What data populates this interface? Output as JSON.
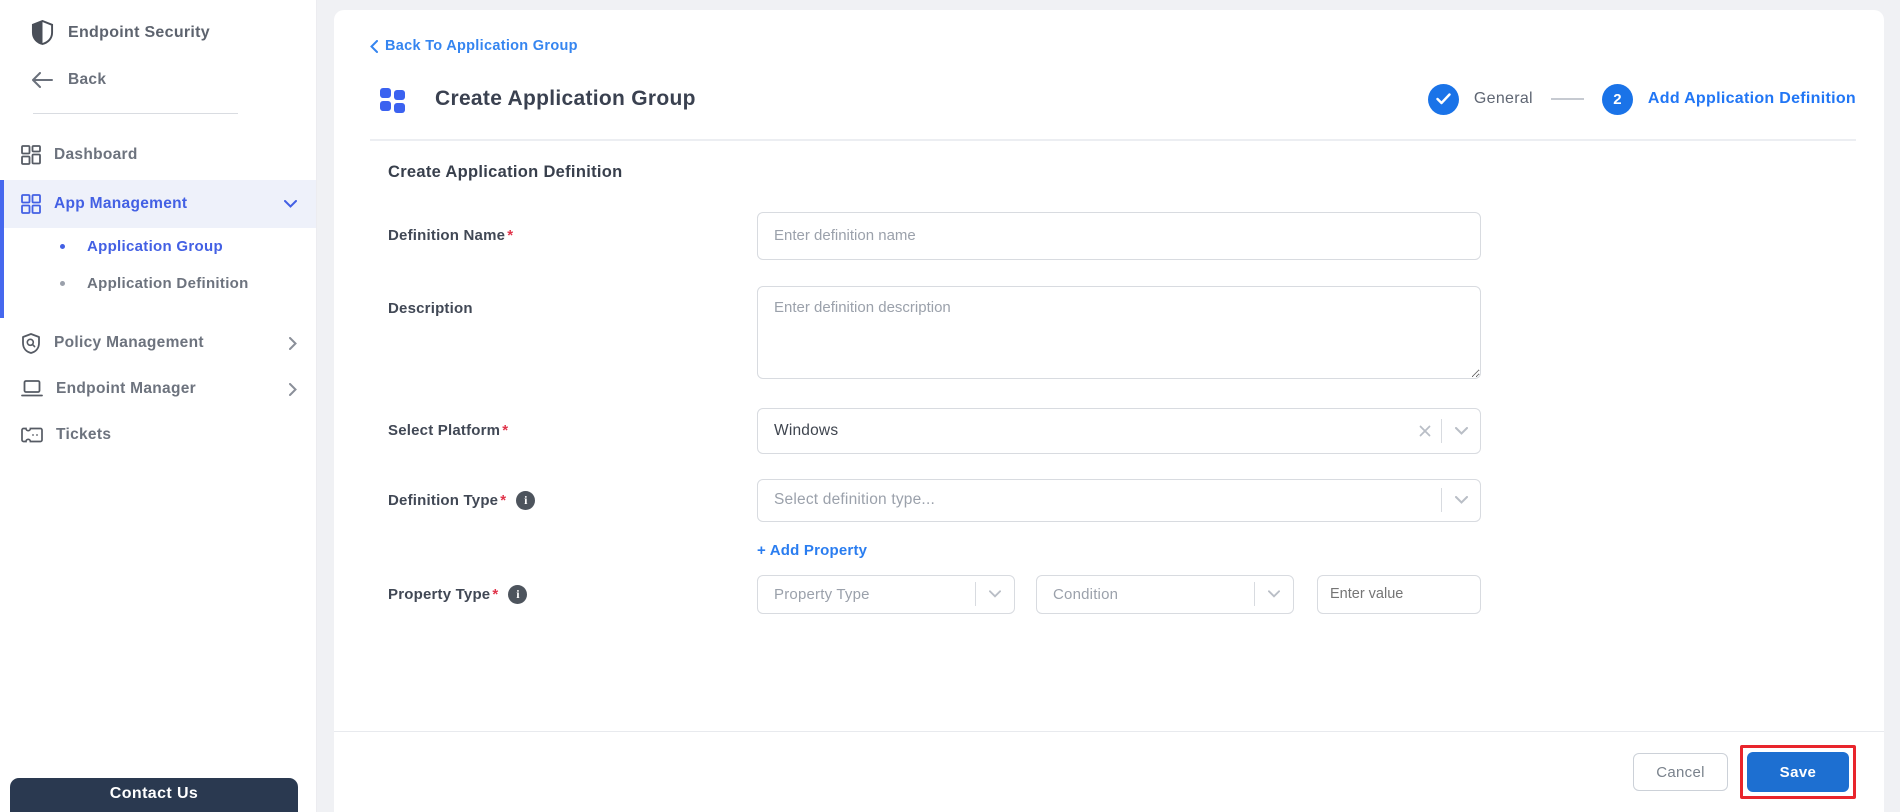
{
  "brand": {
    "name": "Endpoint Security",
    "back_label": "Back",
    "contact_us_label": "Contact Us"
  },
  "sidebar": {
    "items": [
      {
        "label": "Dashboard"
      },
      {
        "label": "App Management",
        "children": [
          {
            "label": "Application Group"
          },
          {
            "label": "Application Definition"
          }
        ]
      },
      {
        "label": "Policy Management"
      },
      {
        "label": "Endpoint Manager"
      },
      {
        "label": "Tickets"
      }
    ]
  },
  "header": {
    "back_link": "Back To Application Group",
    "title": "Create Application Group",
    "steps": [
      {
        "label": "General",
        "state": "done"
      },
      {
        "label": "Add Application Definition",
        "number": "2",
        "state": "active"
      }
    ]
  },
  "form": {
    "section_title": "Create Application Definition",
    "required_mark": "*",
    "definition_name": {
      "label": "Definition Name",
      "placeholder": "Enter definition name",
      "value": ""
    },
    "description": {
      "label": "Description",
      "placeholder": "Enter definition description",
      "value": ""
    },
    "select_platform": {
      "label": "Select Platform",
      "value": "Windows"
    },
    "definition_type": {
      "label": "Definition Type",
      "placeholder": "Select definition type..."
    },
    "add_property_label": "+ Add Property",
    "property_type": {
      "label": "Property Type",
      "type_placeholder": "Property Type",
      "condition_placeholder": "Condition",
      "value_placeholder": "Enter value"
    }
  },
  "footer": {
    "cancel_label": "Cancel",
    "save_label": "Save"
  },
  "colors": {
    "accent_blue": "#2176f5",
    "sidebar_active": "#4360e4",
    "step_blue": "#1a73e8",
    "save_blue": "#1d6fd1",
    "annotation_red": "#e8252c",
    "contact_navy": "#2a3950"
  }
}
